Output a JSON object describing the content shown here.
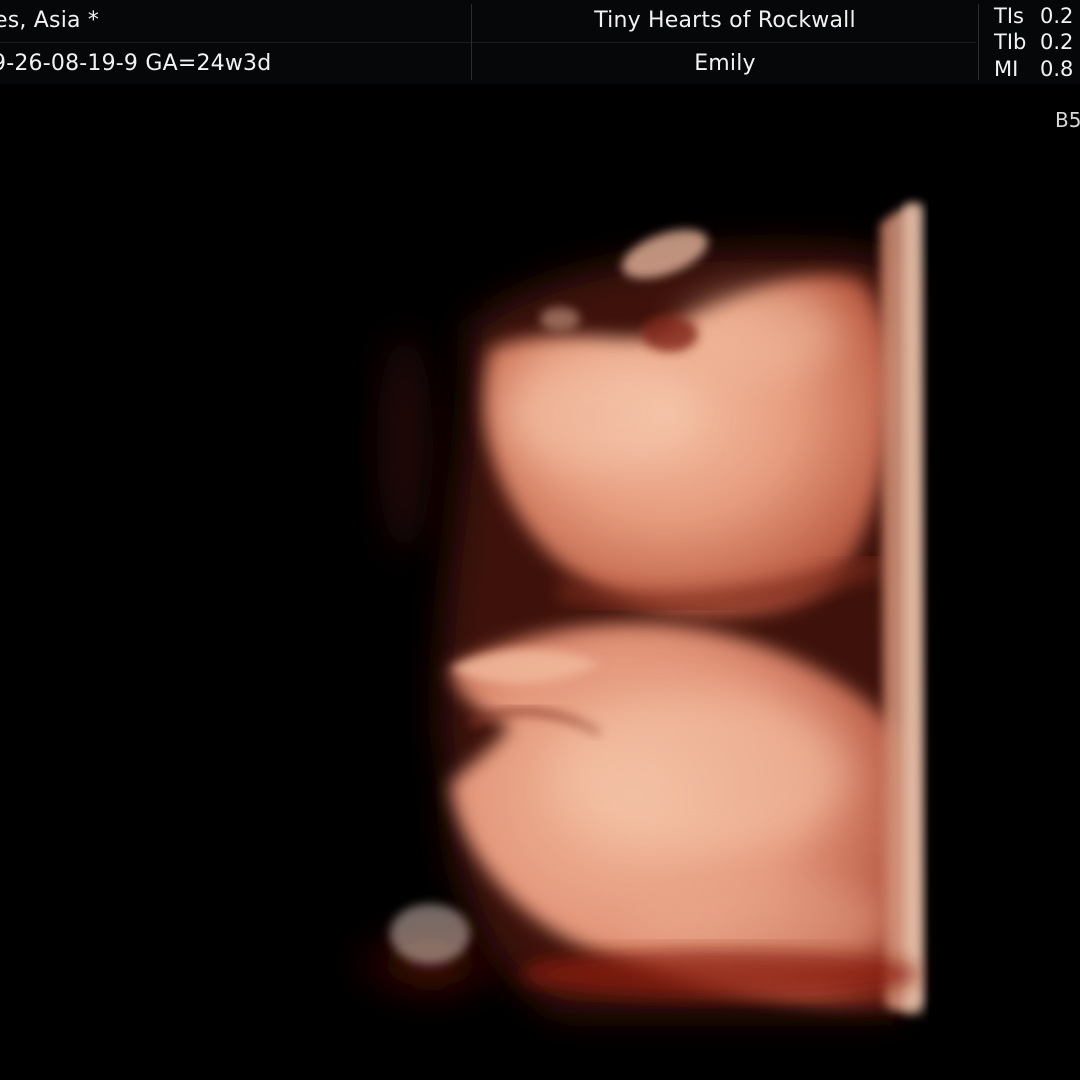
{
  "header": {
    "patient_name": "es, Asia  *",
    "patient_id_ga": "9-26-08-19-9   GA=24w3d",
    "clinic": "Tiny Hearts of Rockwall",
    "operator": "Emily"
  },
  "metrics": [
    {
      "label": "TIs",
      "value": "0.2"
    },
    {
      "label": "TIb",
      "value": "0.2"
    },
    {
      "label": "MI",
      "value": "0.8"
    }
  ],
  "mode_label": "B5",
  "colors": {
    "background": "#000000",
    "header_bg": "#060708",
    "text": "#f2f2f2",
    "render_skin_light": "#f2b79a",
    "render_skin_mid": "#d98a6c",
    "render_skin_dark": "#8a3324"
  },
  "image": {
    "subject": "3d-ultrasound-render"
  }
}
